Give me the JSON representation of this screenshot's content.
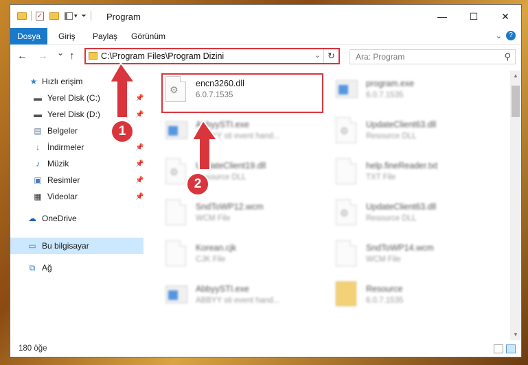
{
  "window": {
    "title": "Program",
    "controls": {
      "minimize": "—",
      "maximize": "☐",
      "close": "✕"
    }
  },
  "ribbon": {
    "tabs": [
      "Dosya",
      "Giriş",
      "Paylaş",
      "Görünüm"
    ]
  },
  "navigation": {
    "back": "←",
    "forward": "→",
    "recent": "⌄",
    "up": "↑",
    "address": "C:\\Program Files\\Program Dizini",
    "search_placeholder": "Ara: Program"
  },
  "sidebar": {
    "items": [
      {
        "label": "Hızlı erişim",
        "icon": "star-icon",
        "pinned": false
      },
      {
        "label": "Yerel Disk (C:)",
        "icon": "drive-icon",
        "pinned": true
      },
      {
        "label": "Yerel Disk (D:)",
        "icon": "drive-icon",
        "pinned": true
      },
      {
        "label": "Belgeler",
        "icon": "documents-icon",
        "pinned": true
      },
      {
        "label": "İndirmeler",
        "icon": "download-icon",
        "pinned": true
      },
      {
        "label": "Müzik",
        "icon": "music-icon",
        "pinned": true
      },
      {
        "label": "Resimler",
        "icon": "pictures-icon",
        "pinned": true
      },
      {
        "label": "Videolar",
        "icon": "video-icon",
        "pinned": true
      },
      {
        "label": "OneDrive",
        "icon": "cloud-icon",
        "pinned": false
      },
      {
        "label": "Bu bilgisayar",
        "icon": "computer-icon",
        "pinned": false,
        "selected": true
      },
      {
        "label": "Ağ",
        "icon": "network-icon",
        "pinned": false
      }
    ]
  },
  "files": [
    {
      "name": "encn3260.dll",
      "sub": "6.0.7.1535",
      "icon": "dll-icon",
      "highlighted": true
    },
    {
      "name": "program.exe",
      "sub": "6.0.7.1535",
      "icon": "exe-icon"
    },
    {
      "name": "AbbyySTI.exe",
      "sub": "ABBYY sti event hand...",
      "icon": "exe-icon"
    },
    {
      "name": "UpdateClient63.dll",
      "sub": "Resource DLL",
      "icon": "dll-icon"
    },
    {
      "name": "UpdateClient19.dll",
      "sub": "Resource DLL",
      "icon": "dll-icon"
    },
    {
      "name": "help.fineReader.txt",
      "sub": "TXT File",
      "icon": "txt-icon"
    },
    {
      "name": "SndToWP12.wcm",
      "sub": "WCM File",
      "icon": "file-icon"
    },
    {
      "name": "UpdateClient63.dll",
      "sub": "Resource DLL",
      "icon": "dll-icon"
    },
    {
      "name": "Korean.cjk",
      "sub": "CJK File",
      "icon": "file-icon"
    },
    {
      "name": "SndToWP14.wcm",
      "sub": "WCM File",
      "icon": "file-icon"
    },
    {
      "name": "AbbyySTI.exe",
      "sub": "ABBYY sti event hand...",
      "icon": "exe-icon"
    },
    {
      "name": "Resource",
      "sub": "6.0.7.1535",
      "icon": "folder-icon"
    }
  ],
  "status": {
    "count": "180 öğe"
  },
  "callouts": [
    "1",
    "2"
  ],
  "colors": {
    "accent": "#1979ca",
    "highlight": "#d9353d",
    "selection": "#cce8ff"
  }
}
